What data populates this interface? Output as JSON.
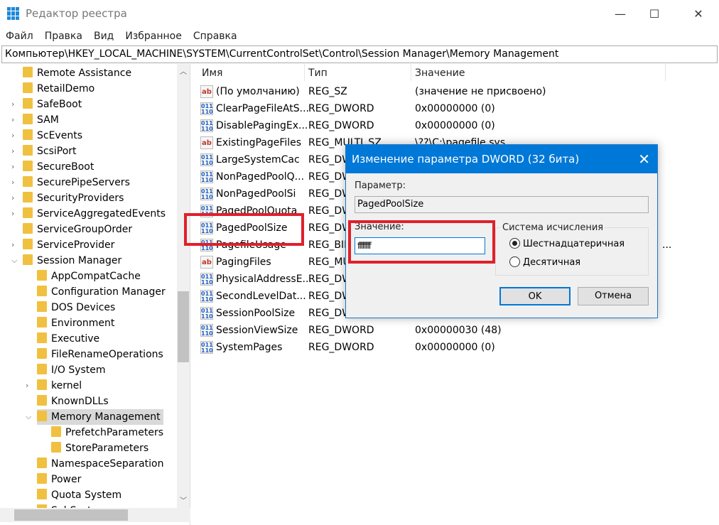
{
  "window": {
    "title": "Редактор реестра",
    "minimize": "—",
    "maximize": "☐",
    "close": "✕"
  },
  "menu": [
    "Файл",
    "Правка",
    "Вид",
    "Избранное",
    "Справка"
  ],
  "address": "Компьютер\\HKEY_LOCAL_MACHINE\\SYSTEM\\CurrentControlSet\\Control\\Session Manager\\Memory Management",
  "tree": [
    {
      "label": "Remote Assistance",
      "level": 1,
      "expander": "none"
    },
    {
      "label": "RetailDemo",
      "level": 1,
      "expander": "none"
    },
    {
      "label": "SafeBoot",
      "level": 1,
      "expander": "collapsed"
    },
    {
      "label": "SAM",
      "level": 1,
      "expander": "collapsed"
    },
    {
      "label": "ScEvents",
      "level": 1,
      "expander": "collapsed"
    },
    {
      "label": "ScsiPort",
      "level": 1,
      "expander": "collapsed"
    },
    {
      "label": "SecureBoot",
      "level": 1,
      "expander": "collapsed"
    },
    {
      "label": "SecurePipeServers",
      "level": 1,
      "expander": "collapsed"
    },
    {
      "label": "SecurityProviders",
      "level": 1,
      "expander": "collapsed"
    },
    {
      "label": "ServiceAggregatedEvents",
      "level": 1,
      "expander": "collapsed"
    },
    {
      "label": "ServiceGroupOrder",
      "level": 1,
      "expander": "none"
    },
    {
      "label": "ServiceProvider",
      "level": 1,
      "expander": "collapsed"
    },
    {
      "label": "Session Manager",
      "level": 1,
      "expander": "expanded"
    },
    {
      "label": "AppCompatCache",
      "level": 2,
      "expander": "none"
    },
    {
      "label": "Configuration Manager",
      "level": 2,
      "expander": "none"
    },
    {
      "label": "DOS Devices",
      "level": 2,
      "expander": "none"
    },
    {
      "label": "Environment",
      "level": 2,
      "expander": "none"
    },
    {
      "label": "Executive",
      "level": 2,
      "expander": "none"
    },
    {
      "label": "FileRenameOperations",
      "level": 2,
      "expander": "none"
    },
    {
      "label": "I/O System",
      "level": 2,
      "expander": "none"
    },
    {
      "label": "kernel",
      "level": 2,
      "expander": "collapsed"
    },
    {
      "label": "KnownDLLs",
      "level": 2,
      "expander": "none"
    },
    {
      "label": "Memory Management",
      "level": 2,
      "expander": "expanded",
      "selected": true
    },
    {
      "label": "PrefetchParameters",
      "level": 3,
      "expander": "none"
    },
    {
      "label": "StoreParameters",
      "level": 3,
      "expander": "none"
    },
    {
      "label": "NamespaceSeparation",
      "level": 2,
      "expander": "none"
    },
    {
      "label": "Power",
      "level": 2,
      "expander": "none"
    },
    {
      "label": "Quota System",
      "level": 2,
      "expander": "none"
    },
    {
      "label": "SubSystems",
      "level": 2,
      "expander": "none"
    }
  ],
  "columns": {
    "name": "Имя",
    "type": "Тип",
    "value": "Значение"
  },
  "values": [
    {
      "icon": "string",
      "name": "(По умолчанию)",
      "type": "REG_SZ",
      "value": "(значение не присвоено)"
    },
    {
      "icon": "dword",
      "name": "ClearPageFileAtS...",
      "type": "REG_DWORD",
      "value": "0x00000000 (0)"
    },
    {
      "icon": "dword",
      "name": "DisablePagingEx...",
      "type": "REG_DWORD",
      "value": "0x00000000 (0)"
    },
    {
      "icon": "string",
      "name": "ExistingPageFiles",
      "type": "REG_MULTI_SZ",
      "value": "\\??\\C:\\pagefile.sys"
    },
    {
      "icon": "dword",
      "name": "LargeSystemCac",
      "type": "REG_DWORD",
      "value": ""
    },
    {
      "icon": "dword",
      "name": "NonPagedPoolQ...",
      "type": "REG_DWORD",
      "value": ""
    },
    {
      "icon": "dword",
      "name": "NonPagedPoolSi",
      "type": "REG_DWORD",
      "value": ""
    },
    {
      "icon": "dword",
      "name": "PagedPoolQuota",
      "type": "REG_DWORD",
      "value": ""
    },
    {
      "icon": "dword",
      "name": "PagedPoolSize",
      "type": "REG_DWORD",
      "value": ""
    },
    {
      "icon": "dword",
      "name": "PagefileUsage",
      "type": "REG_BINARY",
      "value": "..."
    },
    {
      "icon": "string",
      "name": "PagingFiles",
      "type": "REG_MULTI_SZ",
      "value": ""
    },
    {
      "icon": "dword",
      "name": "PhysicalAddressE...",
      "type": "REG_DWORD",
      "value": ""
    },
    {
      "icon": "dword",
      "name": "SecondLevelDat...",
      "type": "REG_DWORD",
      "value": ""
    },
    {
      "icon": "dword",
      "name": "SessionPoolSize",
      "type": "REG_DWORD",
      "value": ""
    },
    {
      "icon": "dword",
      "name": "SessionViewSize",
      "type": "REG_DWORD",
      "value": "0x00000030 (48)"
    },
    {
      "icon": "dword",
      "name": "SystemPages",
      "type": "REG_DWORD",
      "value": "0x00000000 (0)"
    }
  ],
  "dialog": {
    "title": "Изменение параметра DWORD (32 бита)",
    "close": "✕",
    "param_label": "Параметр:",
    "param_value": "PagedPoolSize",
    "value_label": "Значение:",
    "value_input": "ffffffff",
    "radix_label": "Система исчисления",
    "radix_hex": "Шестнадцатеричная",
    "radix_dec": "Десятичная",
    "radix_selected": "hex",
    "ok": "OK",
    "cancel": "Отмена"
  },
  "highlight_color": "#e0202a",
  "accent_color": "#0078d7"
}
